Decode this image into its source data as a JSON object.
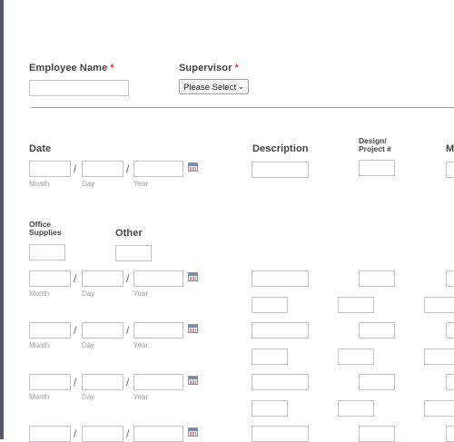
{
  "form": {
    "employee_name_label": "Employee Name",
    "supervisor_label": "Supervisor",
    "required_mark": "*",
    "supervisor_select_value": "Please Select",
    "date_label": "Date",
    "description_label": "Description",
    "design_project_label_line1": "Design/",
    "design_project_label_line2": "Project #",
    "cut_column_label": "M",
    "office_supplies_line1": "Office",
    "office_supplies_line2": "Supplies",
    "other_label": "Other",
    "month_label": "Month",
    "day_label": "Day",
    "year_label": "Year",
    "date_separator": "/"
  },
  "colors": {
    "required": "#e0362c",
    "input_border": "#bfc3c8",
    "left_border": "#55586a"
  }
}
